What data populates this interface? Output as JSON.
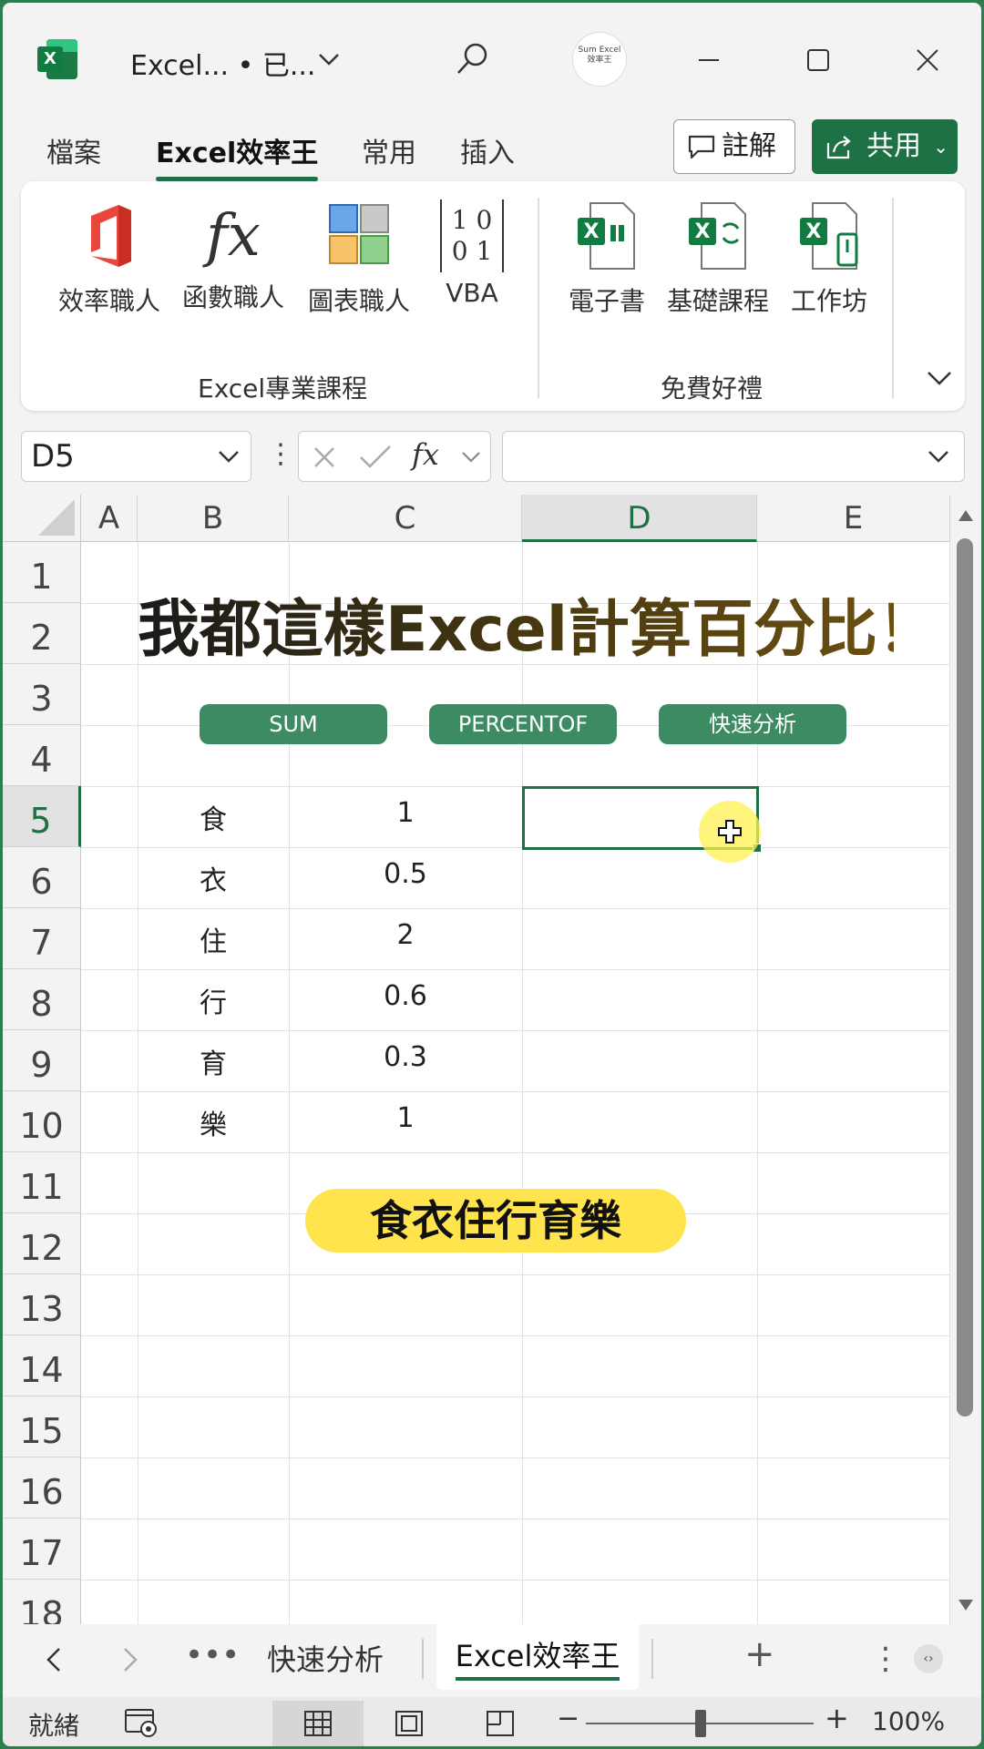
{
  "titlebar": {
    "doc_title": "Excel... • 已...",
    "avatar_text": "Sum Excel 效率王"
  },
  "tabs": {
    "items": [
      "檔案",
      "Excel效率王",
      "常用",
      "插入"
    ],
    "comment_label": "註解",
    "share_label": "共用"
  },
  "ribbon": {
    "items": [
      "效率職人",
      "函數職人",
      "圖表職人",
      "VBA",
      "電子書",
      "基礎課程",
      "工作坊"
    ],
    "groups": [
      "Excel專業課程",
      "免費好禮"
    ],
    "fx_glyph": "fx",
    "vba_glyph": "1 0 0 1"
  },
  "formula": {
    "namebox": "D5",
    "value": ""
  },
  "grid": {
    "columns": [
      "A",
      "B",
      "C",
      "D",
      "E"
    ],
    "selected_column": "D",
    "rows": [
      "1",
      "2",
      "3",
      "4",
      "5",
      "6",
      "7",
      "8",
      "9",
      "10",
      "11",
      "12",
      "13",
      "14",
      "15",
      "16",
      "17",
      "18"
    ],
    "selected_row": "5",
    "title": "我都這樣Excel計算百分比！",
    "pills": [
      "SUM",
      "PERCENTOF",
      "快速分析"
    ],
    "categories": [
      "食",
      "衣",
      "住",
      "行",
      "育",
      "樂"
    ],
    "values": [
      "1",
      "0.5",
      "2",
      "0.6",
      "0.3",
      "1"
    ],
    "footer_pill": "食衣住行育樂"
  },
  "sheets": {
    "tabs": [
      "快速分析",
      "Excel效率王"
    ],
    "active": "Excel效率王",
    "more": "•••",
    "add": "+",
    "menu": "⋮"
  },
  "status": {
    "ready": "就緒",
    "zoom_minus": "−",
    "zoom_plus": "+",
    "zoom": "100%"
  },
  "colors": {
    "accent": "#1e7145",
    "pill": "#3d8b62",
    "highlight": "#ffe44d"
  }
}
